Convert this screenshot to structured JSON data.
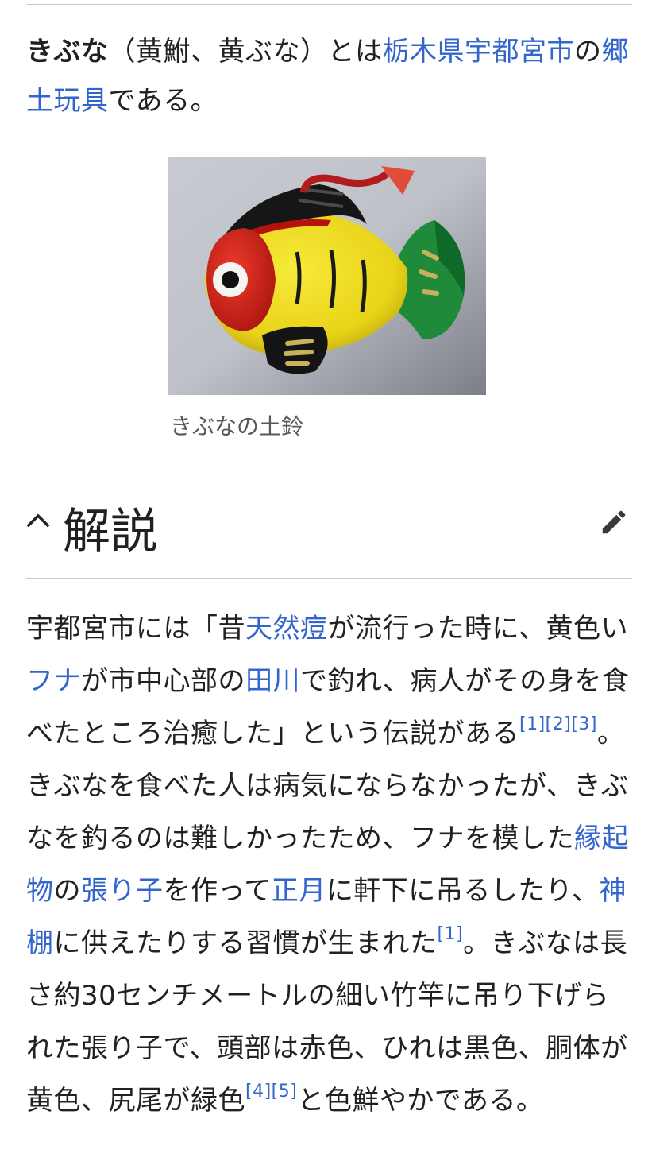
{
  "intro": {
    "title": "きぶな",
    "alt_names": "（黄鮒、黄ぶな）とは",
    "link_city": "栃木県宇都宮市",
    "text_no": "の",
    "link_toy": "郷土玩具",
    "text_end": "である。"
  },
  "figure": {
    "caption": "きぶなの土鈴"
  },
  "section": {
    "title": "解説",
    "collapse_icon": "chevron-up-icon",
    "edit_icon": "pencil-icon"
  },
  "article": {
    "t1": "宇都宮市には「昔",
    "l1": "天然痘",
    "t2": "が流行った時に、黄色い",
    "l2": "フナ",
    "t3": "が市中心部の",
    "l3": "田川",
    "t4": "で釣れ、病人がその身を食べたところ治癒した」という伝説がある",
    "r1": "[1]",
    "r2": "[2]",
    "r3": "[3]",
    "t5": "。きぶなを食べた人は病気にならなかったが、きぶなを釣るのは難しかったため、フナを模した",
    "l4": "縁起物",
    "t6": "の",
    "l5": "張り子",
    "t7": "を作って",
    "l6": "正月",
    "t8": "に軒下に吊るしたり、",
    "l7": "神棚",
    "t9": "に供えたりする習慣が生まれた",
    "r4": "[1]",
    "t10": "。きぶなは長さ約30センチメートルの細い竹竿に吊り下げられた張り子で、頭部は赤色、ひれは黒色、胴体が黄色、尻尾が緑色",
    "r5": "[4]",
    "r6": "[5]",
    "t11": "と色鮮やかである。"
  },
  "colors": {
    "link": "#3366cc",
    "text": "#202122",
    "caption": "#54595d",
    "divider": "#c8ccd1"
  }
}
